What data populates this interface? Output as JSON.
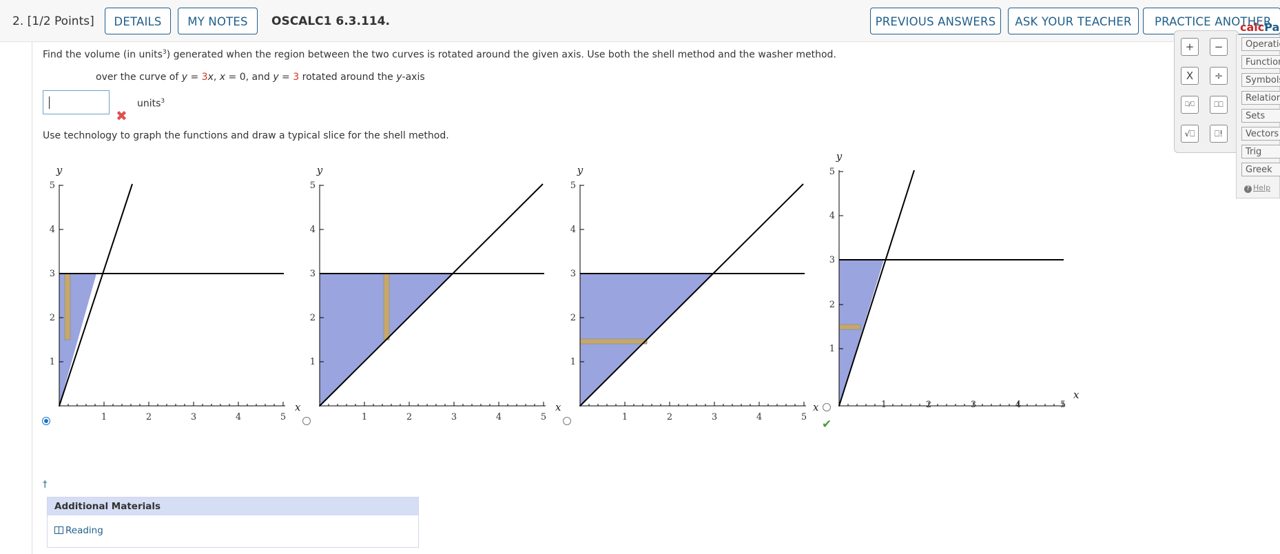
{
  "header": {
    "question_number": "2.",
    "points": "[1/2 Points]",
    "details_label": "DETAILS",
    "my_notes_label": "MY NOTES",
    "problem_code": "OSCALC1 6.3.114.",
    "previous_answers_label": "PREVIOUS ANSWERS",
    "ask_teacher_label": "ASK YOUR TEACHER",
    "practice_label": "PRACTICE ANOTHER"
  },
  "problem": {
    "intro_a": "Find the volume (in units",
    "intro_sup": "3",
    "intro_b": ") generated when the region between the two curves is rotated around the given axis. Use both the shell method and the washer method.",
    "region_a": "over the curve of ",
    "region_y": "y",
    "region_eq": " = ",
    "region_3": "3",
    "region_x": "x",
    "region_b": ", ",
    "region_x2": "x",
    "region_c": " = 0, and ",
    "region_y2": "y",
    "region_d": " = ",
    "region_3b": "3",
    "region_e": " rotated around the ",
    "region_axis": "y",
    "region_f": "-axis",
    "answer_value": "",
    "answer_unit": "units",
    "answer_unit_sup": "3",
    "answer_status": "incorrect",
    "technology_prompt": "Use technology to graph the functions and draw a typical slice for the shell method."
  },
  "graph_labels": {
    "y_axis": "y",
    "x_axis": "x",
    "ticks": [
      "1",
      "2",
      "3",
      "4",
      "5"
    ]
  },
  "graphs": [
    {
      "option": 1,
      "selected": true,
      "correct": false
    },
    {
      "option": 2,
      "selected": false,
      "correct": false
    },
    {
      "option": 3,
      "selected": false,
      "correct": false
    },
    {
      "option": 4,
      "selected": false,
      "correct": true
    }
  ],
  "footer": {
    "dagger": "†",
    "additional_materials": "Additional Materials",
    "reading_label": "Reading"
  },
  "calcpad": {
    "title_a": "calc",
    "title_b": "Pad",
    "buttons": [
      "+",
      "−",
      "X",
      "÷",
      "⎕/⎕",
      "⎕⎕",
      "√⎕",
      "⎕!"
    ],
    "tabs": [
      "Operations",
      "Functions",
      "Symbols",
      "Relations",
      "Sets",
      "Vectors",
      "Trig",
      "Greek"
    ],
    "help_label": "Help"
  },
  "colors": {
    "accent": "#1f5f8b",
    "fill": "#9aa4de",
    "slice": "#c9a76a"
  }
}
